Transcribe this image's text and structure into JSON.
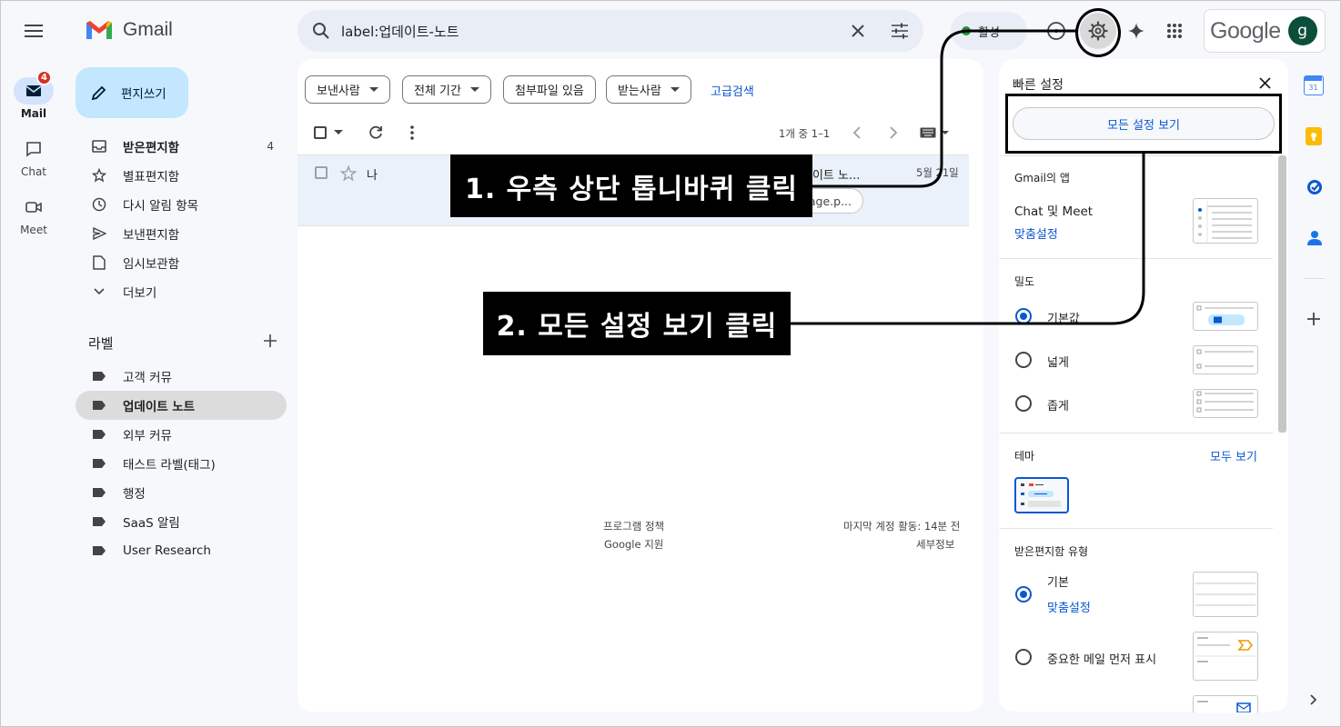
{
  "app": {
    "name": "Gmail"
  },
  "rail": {
    "mail_label": "Mail",
    "mail_badge": "4",
    "chat_label": "Chat",
    "meet_label": "Meet"
  },
  "compose_label": "편지쓰기",
  "nav": {
    "items": [
      {
        "label": "받은편지함",
        "count": "4"
      },
      {
        "label": "별표편지함"
      },
      {
        "label": "다시 알림 항목"
      },
      {
        "label": "보낸편지함"
      },
      {
        "label": "임시보관함"
      },
      {
        "label": "더보기"
      }
    ],
    "labels_heading": "라벨",
    "labels": [
      "고객 커뮤",
      "업데이트 노트",
      "외부 커뮤",
      "태스트 라벨(태그)",
      "행정",
      "SaaS 알림",
      "User Research"
    ]
  },
  "search": {
    "query": "label:업데이트-노트"
  },
  "header": {
    "status": "활성",
    "google_logo": "Google",
    "avatar_letter": "g"
  },
  "filters": {
    "chips": [
      "보낸사람",
      "전체 기간",
      "첨부파일 있음",
      "받는사람"
    ],
    "advanced": "고급검색"
  },
  "toolbar": {
    "pagination": "1개 중 1–1"
  },
  "message": {
    "sender": "나",
    "subject_partial": "네이트 노...",
    "date": "5월 21일",
    "attachment_partial": "age.p..."
  },
  "footer": {
    "policy": "프로그램 정책",
    "support": "Google 지원",
    "last_activity": "마지막 계정 활동: 14분 전",
    "details": "세부정보"
  },
  "quick_settings": {
    "title": "빠른 설정",
    "see_all": "모든 설정 보기",
    "apps_heading": "Gmail의 앱",
    "apps_item": "Chat 및 Meet",
    "apps_customize": "맞춤설정",
    "density_heading": "밀도",
    "density_options": [
      "기본값",
      "넓게",
      "좁게"
    ],
    "theme_heading": "테마",
    "theme_view_all": "모두 보기",
    "inbox_heading": "받은편지함 유형",
    "inbox_default": "기본",
    "inbox_customize": "맞춤설정",
    "inbox_important": "중요한 메일 먼저 표시"
  },
  "annotations": {
    "step1": "1. 우측 상단 톱니바퀴 클릭",
    "step2": "2. 모든 설정 보기 클릭"
  },
  "colors": {
    "accent": "#0b57d0",
    "compose_bg": "#c2e7ff",
    "search_bg": "#e9eef6",
    "active_label_bg": "#dcdcdc"
  }
}
